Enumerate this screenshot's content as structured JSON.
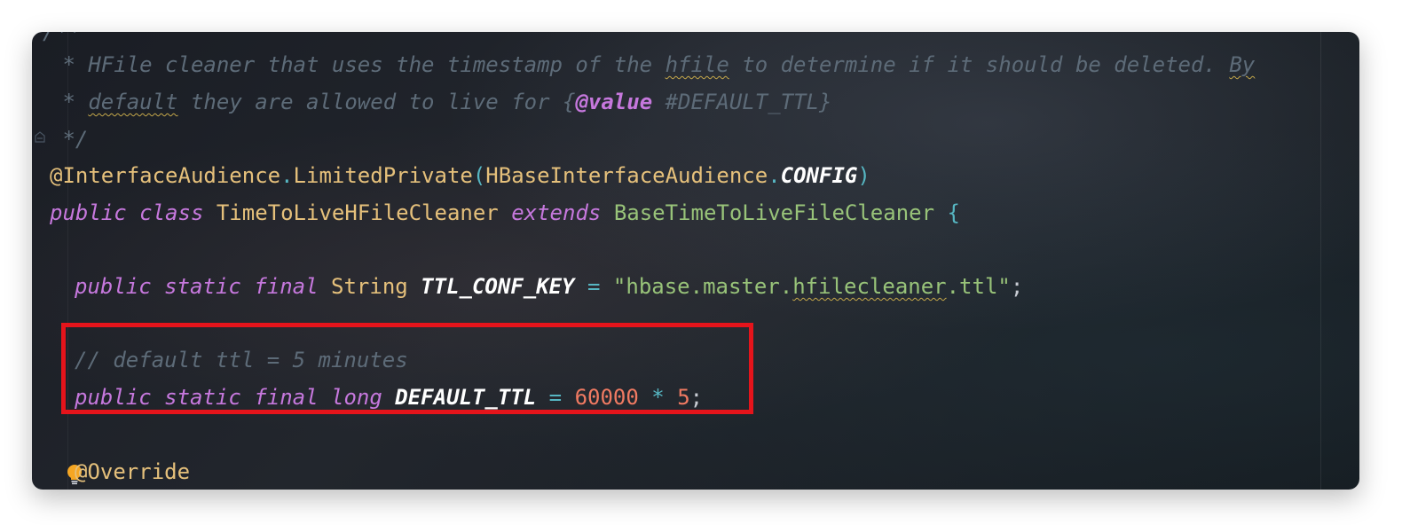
{
  "code": {
    "partial_top": "/**",
    "doc_line1": {
      "prefix": " * HFile cleaner that uses the timestamp of the ",
      "hfile": "hfile",
      "mid": " to determine if it should be deleted. ",
      "by": "By"
    },
    "doc_line2": {
      "prefix": " * ",
      "default": "default",
      "mid": " they are allowed to live for {",
      "tag": "@value",
      "rest": " #DEFAULT_TTL}"
    },
    "doc_line3": " */",
    "annotation_line": {
      "at_name": "@InterfaceAudience",
      "dot1": ".",
      "method": "LimitedPrivate",
      "paren_open": "(",
      "arg_cls": "HBaseInterfaceAudience",
      "dot2": ".",
      "arg_const": "CONFIG",
      "paren_close": ")"
    },
    "class_line": {
      "public": "public",
      "class": "class",
      "name": "TimeToLiveHFileCleaner",
      "extends": "extends",
      "super": "BaseTimeToLiveFileCleaner",
      "brace": "{"
    },
    "ttl_conf_line": {
      "public": "public",
      "static": "static",
      "final": "final",
      "type": "String",
      "name": "TTL_CONF_KEY",
      "eq": "=",
      "str_a": "\"hbase.master.",
      "str_b": "hfilecleaner",
      "str_c": ".ttl\"",
      "semi": ";"
    },
    "comment_line": "// default ttl = 5 minutes",
    "default_ttl_line": {
      "public": "public",
      "static": "static",
      "final": "final",
      "type": "long",
      "name": "DEFAULT_TTL",
      "eq": "=",
      "num1": "60000",
      "op": "*",
      "num2": "5",
      "semi": ";"
    },
    "override_line": "@Override"
  },
  "colors": {
    "highlight_border": "#e5141b",
    "keyword": "#c678dd",
    "type": "#e5c07b",
    "string": "#98c379",
    "number": "#f07a62",
    "comment": "#5d6b78"
  },
  "icons": [
    "fold-icon",
    "lightbulb-icon"
  ]
}
